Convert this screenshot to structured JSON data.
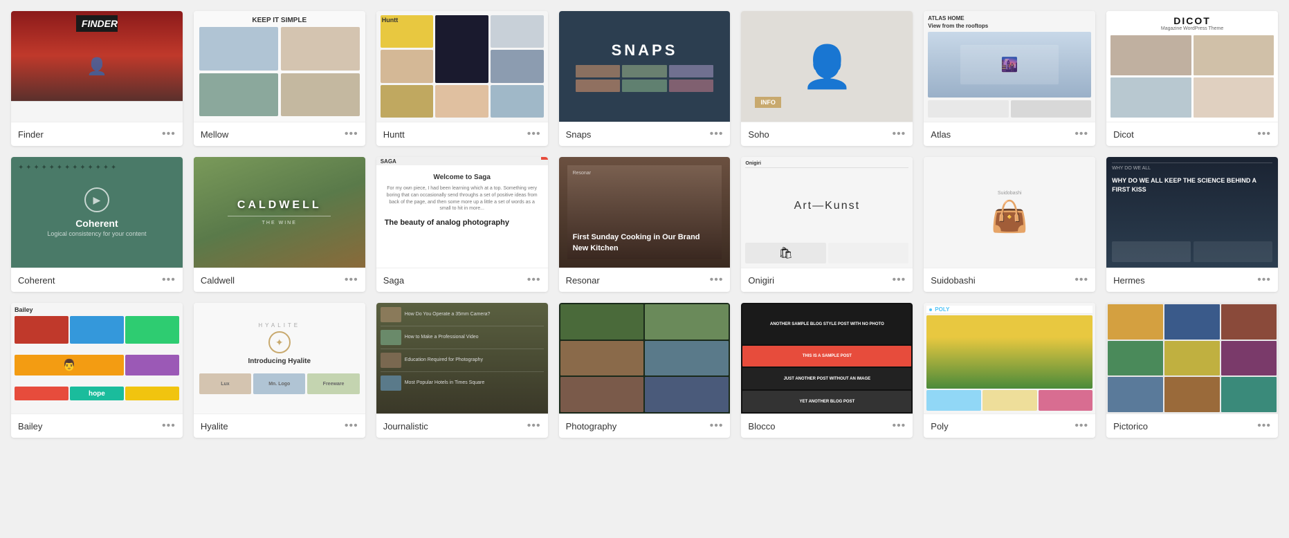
{
  "themes": {
    "row1": [
      {
        "id": "finder",
        "name": "Finder",
        "type": "finder"
      },
      {
        "id": "mellow",
        "name": "Mellow",
        "type": "mellow"
      },
      {
        "id": "huntt",
        "name": "Huntt",
        "type": "huntt"
      },
      {
        "id": "snaps",
        "name": "Snaps",
        "type": "snaps"
      },
      {
        "id": "soho",
        "name": "Soho",
        "type": "soho"
      },
      {
        "id": "atlas",
        "name": "Atlas",
        "type": "atlas"
      },
      {
        "id": "dicot",
        "name": "Dicot",
        "type": "dicot"
      }
    ],
    "row2": [
      {
        "id": "coherent",
        "name": "Coherent",
        "type": "coherent"
      },
      {
        "id": "caldwell",
        "name": "Caldwell",
        "type": "caldwell"
      },
      {
        "id": "saga",
        "name": "Saga",
        "type": "saga"
      },
      {
        "id": "resonar",
        "name": "Resonar",
        "type": "resonar"
      },
      {
        "id": "onigiri",
        "name": "Onigiri",
        "type": "onigiri"
      },
      {
        "id": "suidobashi",
        "name": "Suidobashi",
        "type": "suidobashi"
      },
      {
        "id": "hermes",
        "name": "Hermes",
        "type": "hermes"
      }
    ],
    "row3": [
      {
        "id": "bailey",
        "name": "Bailey",
        "type": "bailey"
      },
      {
        "id": "hyalite",
        "name": "Hyalite",
        "type": "hyalite"
      },
      {
        "id": "journalistic",
        "name": "Journalistic",
        "type": "journalistic"
      },
      {
        "id": "photography",
        "name": "Photography",
        "type": "photography"
      },
      {
        "id": "blocco",
        "name": "Blocco",
        "type": "blocco"
      },
      {
        "id": "poly",
        "name": "Poly",
        "type": "poly"
      },
      {
        "id": "pictorico",
        "name": "Pictorico",
        "type": "pictorico"
      }
    ]
  },
  "more_label": "•••",
  "finder": {
    "logo": "FINDER"
  },
  "mellow": {
    "title": "KEEP IT SIMPLE"
  },
  "snaps": {
    "title": "SNAPS"
  },
  "soho": {
    "badge": "INFO"
  },
  "coherent": {
    "title": "Coherent",
    "subtitle": "Logical consistency for your content"
  },
  "caldwell": {
    "title": "CALDWELL"
  },
  "saga": {
    "tag": "SAGA",
    "headline": "Welcome to Saga",
    "quote": "The beauty of analog photography"
  },
  "resonar": {
    "text": "First Sunday Cooking in Our Brand New Kitchen"
  },
  "onigiri": {
    "title": "Onigiri",
    "subtitle": "Art—Kunst"
  },
  "atlas": {
    "title": "ATLAS HOME",
    "subtitle": "View from the rooftops"
  },
  "dicot": {
    "title": "DICOT",
    "subtitle": "Magazine WordPress Theme"
  },
  "hyalite": {
    "brand": "HYALITE",
    "headline": "Introducing Hyalite"
  },
  "journalistic": {
    "caption1": "How Do You Operate a 35mm Camera?",
    "caption2": "How to Make a Professional Video",
    "caption3": "Education Required for Photography",
    "caption4": "Most Popular Hotels in Times Square"
  },
  "hermes": {
    "title": "WHY DO WE ALL KEEP THE SCIENCE BEHIND A FIRST KISS"
  },
  "poly": {
    "accent": "#4fc3f7"
  },
  "blocco": {
    "text1": "ANOTHER SAMPLE BLOG STYLE POST WITH NO PHOTO",
    "text2": "THIS IS A SAMPLE POST",
    "text3": "JUST ANOTHER POST WITHOUT AN IMAGE",
    "text4": "YET ANOTHER BLOG POST"
  }
}
